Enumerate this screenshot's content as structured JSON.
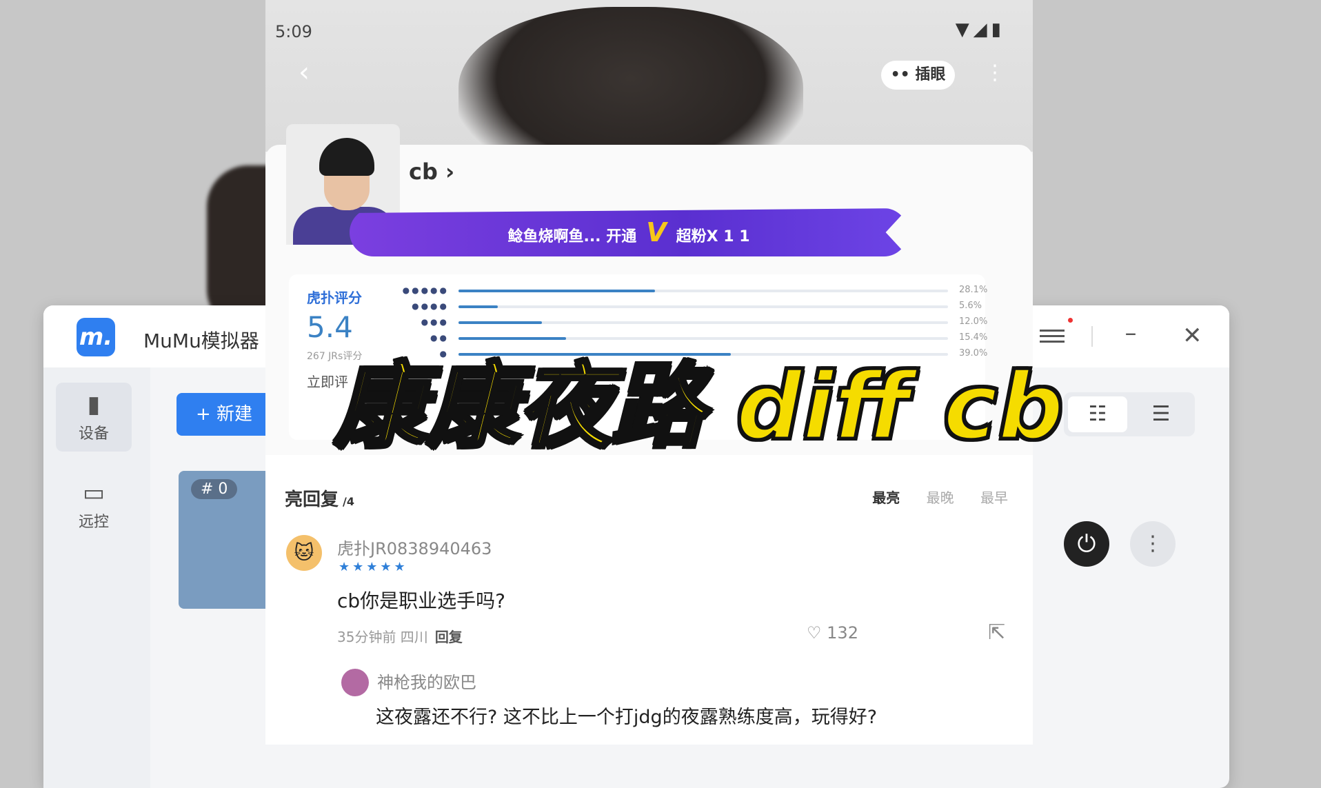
{
  "caption": "康康夜路 diff cb",
  "mumu": {
    "title": "MuMu模拟器",
    "new_button": "+ 新建",
    "sidebar": [
      {
        "label": "设备",
        "icon": "device-icon"
      },
      {
        "label": "远控",
        "icon": "remote-icon"
      }
    ],
    "device_badge": "# 0",
    "menu_icon": "menu-icon",
    "min_label": "–",
    "close_label": "✕"
  },
  "phone": {
    "status_time": "5:09",
    "status_icons": "▼◢▮",
    "pip_label": "•• 插眼",
    "user": {
      "name": "cb ›",
      "vip_banner_left": "鲶鱼烧啊鱼... 开通",
      "vip_mark": "V",
      "vip_banner_right": "超粉X 1  1"
    },
    "rating": {
      "label": "虎扑评分",
      "score": "5.4",
      "count": "267 JRs评分",
      "action": "立即评",
      "rows": [
        {
          "stars": "●●●●●",
          "pct": "28.1%",
          "fraction": 0.281
        },
        {
          "stars": "●●●●",
          "pct": "5.6%",
          "fraction": 0.056
        },
        {
          "stars": "●●●",
          "pct": "12.0%",
          "fraction": 0.12
        },
        {
          "stars": "●●",
          "pct": "15.4%",
          "fraction": 0.154
        },
        {
          "stars": "●",
          "pct": "39.0%",
          "fraction": 0.39
        }
      ]
    },
    "replies": {
      "title": "亮回复",
      "count": "/4",
      "sort": [
        "最亮",
        "最晚",
        "最早"
      ],
      "comment": {
        "user": "虎扑JR0838940463",
        "stars": "★★★★★",
        "text": "cb你是职业选手吗?",
        "time": "35分钟前 四川",
        "reply": "回复",
        "likes": "132"
      },
      "sub_reply": {
        "user": "神枪我的欧巴",
        "text": "这夜露还不行? 这不比上一个打jdg的夜露熟练度高，玩得好?"
      }
    }
  }
}
